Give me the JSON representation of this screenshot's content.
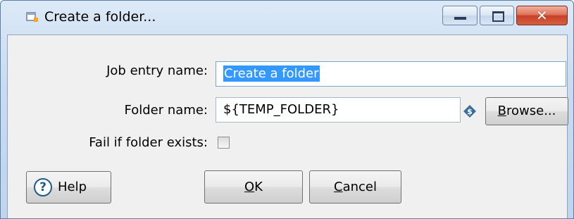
{
  "window": {
    "title": "Create a folder...",
    "minimize_icon": "minimize-icon",
    "maximize_icon": "maximize-icon",
    "close_icon": "close-icon"
  },
  "form": {
    "job_entry_label": "Job entry name:",
    "job_entry_value": "Create a folder",
    "folder_name_label": "Folder name:",
    "folder_name_value": "${TEMP_FOLDER}",
    "fail_if_exists_label": "Fail if folder exists:",
    "fail_if_exists_checked": false
  },
  "buttons": {
    "browse": {
      "mnemonic": "B",
      "rest": "rowse..."
    },
    "help": "Help",
    "ok": {
      "mnemonic": "O",
      "rest": "K"
    },
    "cancel": {
      "mnemonic": "C",
      "rest": "ancel"
    }
  },
  "colors": {
    "selection": "#3399ff",
    "close_button": "#c7412a",
    "titlebar": "#c8dbf1"
  }
}
